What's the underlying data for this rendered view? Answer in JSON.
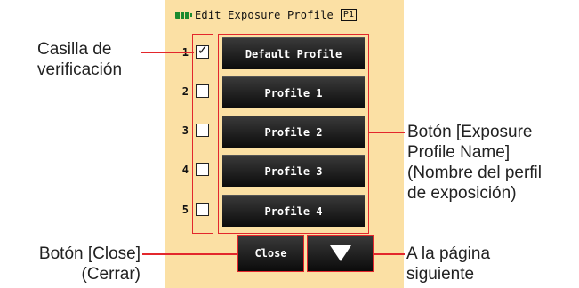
{
  "header": {
    "title": "Edit Exposure Profile",
    "page_badge": "P1"
  },
  "rows": [
    {
      "number": "1",
      "checked": true,
      "label": "Default Profile"
    },
    {
      "number": "2",
      "checked": false,
      "label": "Profile 1"
    },
    {
      "number": "3",
      "checked": false,
      "label": "Profile 2"
    },
    {
      "number": "4",
      "checked": false,
      "label": "Profile 3"
    },
    {
      "number": "5",
      "checked": false,
      "label": "Profile 4"
    }
  ],
  "buttons": {
    "close_label": "Close"
  },
  "annotations": {
    "checkbox_line1": "Casilla de",
    "checkbox_line2": "verificación",
    "profile_line1": "Botón [Exposure",
    "profile_line2": "Profile Name]",
    "profile_line3": "(Nombre del perfil",
    "profile_line4": "de exposición)",
    "close_line1": "Botón [Close]",
    "close_line2": "(Cerrar)",
    "next_line1": "A la página",
    "next_line2": "siguiente"
  },
  "colors": {
    "panel_bg": "#fbe0a4",
    "highlight": "#e3272c",
    "battery": "#1a8a2e"
  }
}
